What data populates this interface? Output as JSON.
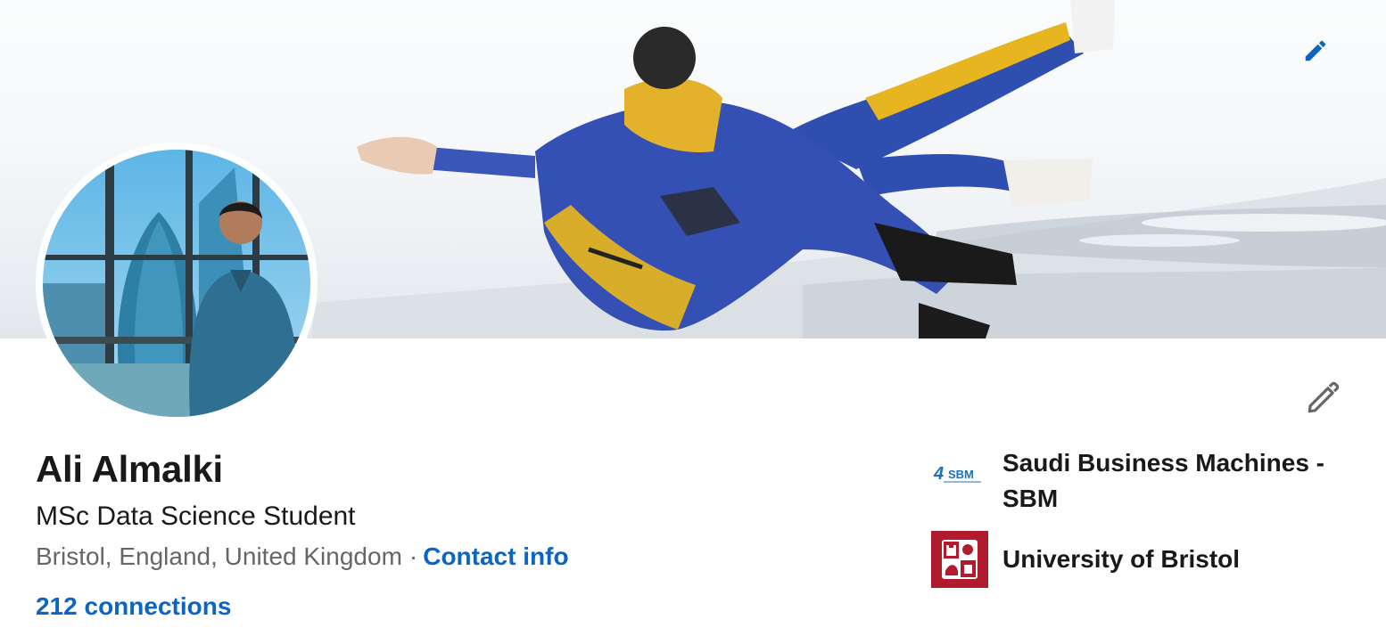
{
  "profile": {
    "name": "Ali Almalki",
    "headline": "MSc Data Science Student",
    "location": "Bristol, England, United Kingdom",
    "separator": "·",
    "contact_info_label": "Contact info",
    "connections_label": "212 connections"
  },
  "organizations": [
    {
      "name": "Saudi Business Machines - SBM",
      "logo_icon": "sbm-logo",
      "logo_text": "SBM"
    },
    {
      "name": "University of Bristol",
      "logo_icon": "university-of-bristol-crest"
    }
  ],
  "icons": {
    "cover_edit": "pencil-icon",
    "intro_edit": "pencil-icon"
  },
  "colors": {
    "link": "#0a66c2",
    "text": "#191919",
    "muted": "#666666",
    "bristol_red": "#b01c2e"
  }
}
